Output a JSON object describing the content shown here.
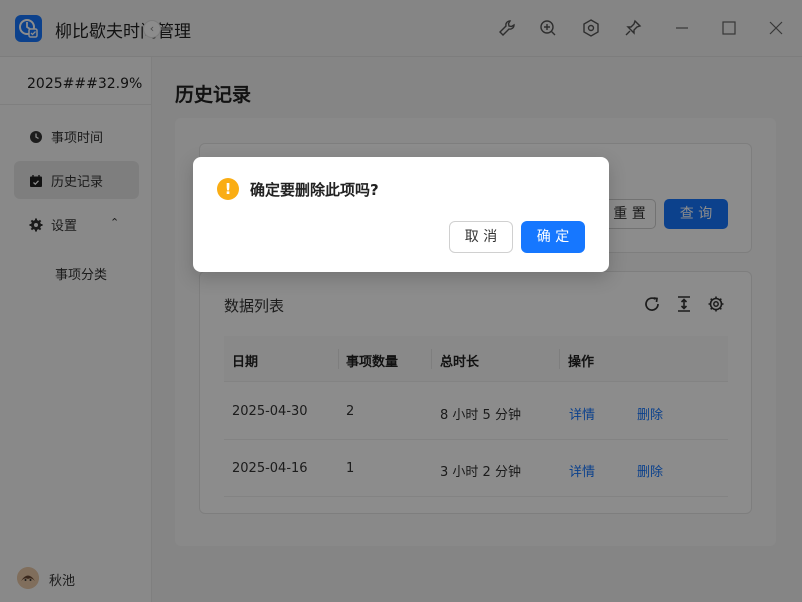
{
  "window": {
    "title": "柳比歇夫时间管理",
    "icons": [
      "wrench-icon",
      "zoom-in-icon",
      "hexagon-settings-icon",
      "pin-icon",
      "minimize-icon",
      "maximize-icon",
      "close-icon"
    ]
  },
  "sidebar": {
    "stat": "2025###32.9%",
    "collapse_label": "‹",
    "items": [
      {
        "label": "事项时间",
        "icon": "clock-icon"
      },
      {
        "label": "历史记录",
        "icon": "calendar-icon",
        "active": true
      },
      {
        "label": "设置",
        "icon": "gear-icon",
        "chevron": "⌃"
      }
    ],
    "sub_items": [
      {
        "label": "事项分类"
      }
    ],
    "user": {
      "name": "秋池"
    }
  },
  "page": {
    "title": "历史记录",
    "filter": {
      "reset_label": "重 置",
      "query_label": "查 询"
    },
    "list": {
      "title": "数据列表",
      "tools": [
        "refresh-icon",
        "column-height-icon",
        "settings-icon"
      ],
      "columns": [
        "日期",
        "事项数量",
        "总时长",
        "操作"
      ],
      "rows": [
        {
          "date": "2025-04-30",
          "count": "2",
          "duration": "8 小时 5 分钟",
          "detail": "详情",
          "delete": "删除"
        },
        {
          "date": "2025-04-16",
          "count": "1",
          "duration": "3 小时 2 分钟",
          "detail": "详情",
          "delete": "删除"
        }
      ]
    }
  },
  "modal": {
    "icon_glyph": "!",
    "message": "确定要删除此项吗?",
    "cancel_label": "取 消",
    "ok_label": "确 定"
  },
  "colors": {
    "primary": "#1677ff",
    "warning": "#faad14",
    "mask": "rgba(0,0,0,0.45)"
  }
}
